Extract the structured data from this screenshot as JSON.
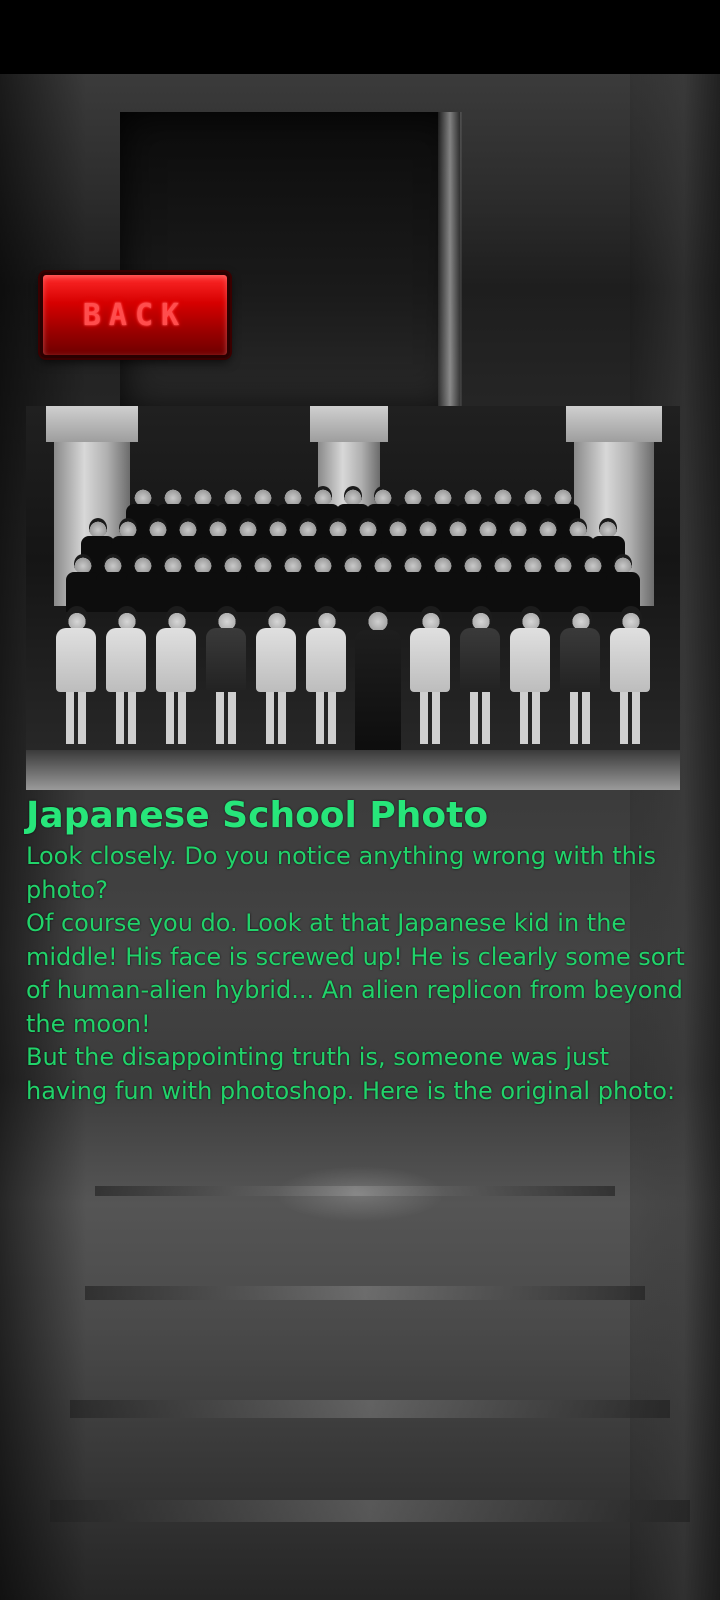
{
  "back_button": {
    "label": "BACK"
  },
  "article": {
    "title": "Japanese School Photo",
    "paragraphs": [
      "Look closely. Do you notice anything wrong with this photo?",
      "Of course you do. Look at that Japanese kid in the middle! His face is screwed up! He is clearly some sort of human-alien hybrid... An alien replicon from beyond the moon!",
      "But the disappointing truth is, someone was just having fun with photoshop. Here is the original photo:"
    ]
  },
  "colors": {
    "title_green": "#27e67a",
    "body_green": "#21d36a",
    "back_button_red": "#d60000",
    "back_label_red": "#ff4d4d"
  },
  "icons": {
    "photo": "school-class-photo"
  }
}
